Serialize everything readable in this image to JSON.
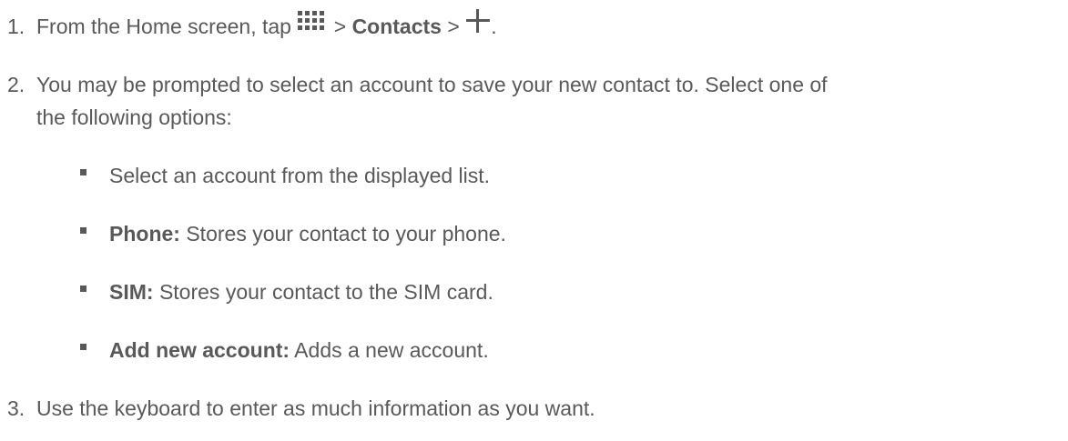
{
  "steps": [
    {
      "number": "1.",
      "parts": {
        "a": "From the Home screen, tap ",
        "sep1": " > ",
        "contacts": "Contacts",
        "sep2": " > ",
        "end": "."
      },
      "icons": [
        "apps-grid-icon",
        "plus-icon"
      ]
    },
    {
      "number": "2.",
      "line1": "You may be prompted to select an account to save your new contact to. Select one of",
      "line2": "the following options:",
      "bullets": [
        {
          "label": "",
          "text": "Select an account from the displayed list."
        },
        {
          "label": "Phone:",
          "text": " Stores your contact to your phone."
        },
        {
          "label": "SIM:",
          "text": " Stores your contact to the SIM card."
        },
        {
          "label": "Add new account:",
          "text": " Adds a new account."
        }
      ]
    },
    {
      "number": "3.",
      "text": "Use the keyboard to enter as much information as you want."
    }
  ]
}
